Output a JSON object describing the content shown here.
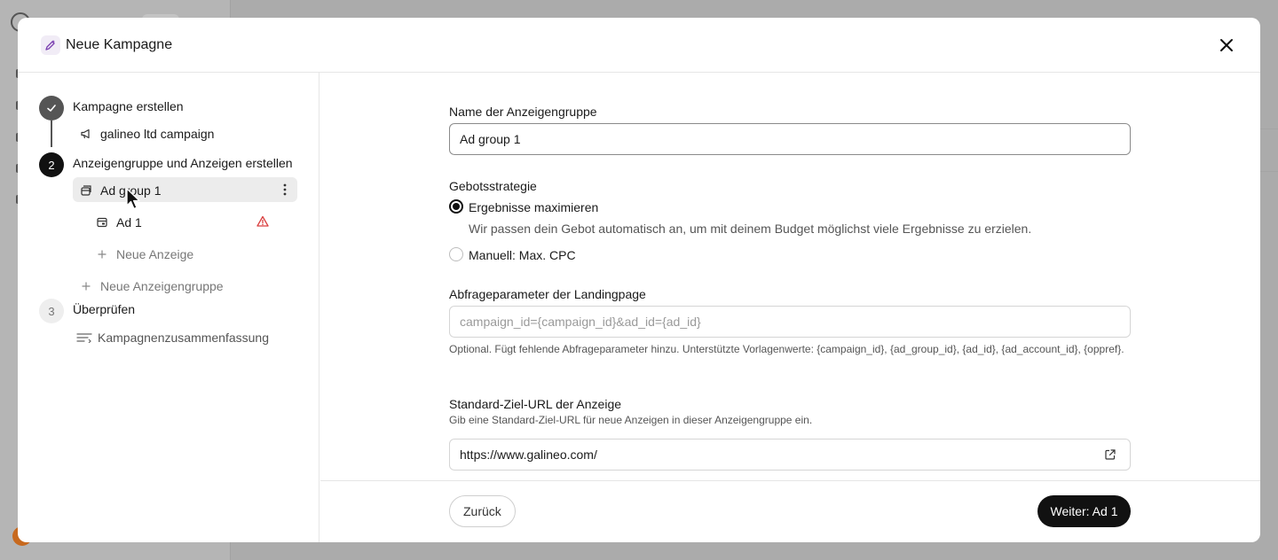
{
  "modal": {
    "title": "Neue Kampagne",
    "header_icon": "pen-sparkle-icon",
    "close_icon": "close-icon"
  },
  "steps": [
    {
      "number": "✓",
      "label": "Kampagne erstellen",
      "state": "done"
    },
    {
      "number": "2",
      "label": "Anzeigengruppe und Anzeigen erstellen",
      "state": "active"
    },
    {
      "number": "3",
      "label": "Überprüfen",
      "state": "todo"
    }
  ],
  "tree": {
    "campaign": {
      "label": "galineo ltd campaign",
      "icon": "megaphone-icon"
    },
    "ad_group": {
      "label": "Ad group 1",
      "icon": "ad-group-icon",
      "menu_icon": "kebab-icon"
    },
    "ad": {
      "label": "Ad 1",
      "icon": "ad-icon",
      "status_icon": "warning-triangle-icon",
      "status_color": "#d93f3f"
    },
    "new_ad": {
      "label": "Neue Anzeige",
      "icon": "plus-icon"
    },
    "new_ad_group": {
      "label": "Neue Anzeigengruppe",
      "icon": "plus-icon"
    },
    "summary": {
      "label": "Kampagnenzusammenfassung",
      "icon": "summary-lines-icon"
    }
  },
  "form": {
    "ad_group_name": {
      "label": "Name der Anzeigengruppe",
      "value": "Ad group 1"
    },
    "bidding": {
      "label": "Gebotsstrategie",
      "options": [
        {
          "label": "Ergebnisse maximieren",
          "description": "Wir passen dein Gebot automatisch an, um mit deinem Budget möglichst viele Ergebnisse zu erzielen.",
          "selected": true
        },
        {
          "label": "Manuell: Max. CPC",
          "selected": false
        }
      ]
    },
    "query_params": {
      "label": "Abfrageparameter der Landingpage",
      "placeholder": "campaign_id={campaign_id}&ad_id={ad_id}",
      "value": "",
      "help": "Optional. Fügt fehlende Abfrageparameter hinzu. Unterstützte Vorlagenwerte: {campaign_id}, {ad_group_id}, {ad_id}, {ad_account_id}, {oppref}."
    },
    "default_url": {
      "label": "Standard-Ziel-URL der Anzeige",
      "help": "Gib eine Standard-Ziel-URL für neue Anzeigen in dieser Anzeigengruppe ein.",
      "value": "https://www.galineo.com/",
      "icon": "external-link-icon"
    }
  },
  "footer": {
    "back_label": "Zurück",
    "next_label": "Weiter: Ad 1"
  },
  "colors": {
    "primary": "#111111",
    "step_done": "#555555",
    "warning": "#d93f3f",
    "accent_purple": "#7b3fb0"
  }
}
